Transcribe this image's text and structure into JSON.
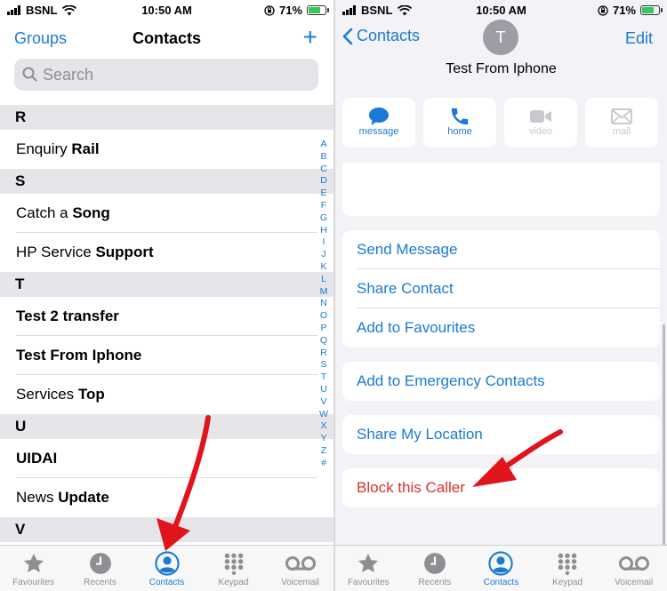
{
  "status": {
    "carrier": "BSNL",
    "time": "10:50 AM",
    "battery": "71%"
  },
  "left": {
    "nav": {
      "groups": "Groups",
      "title": "Contacts",
      "add": "+"
    },
    "search": {
      "placeholder": "Search"
    },
    "sections": [
      {
        "letter": "R",
        "rows": [
          {
            "first": "Enquiry ",
            "last": "Rail"
          }
        ]
      },
      {
        "letter": "S",
        "rows": [
          {
            "first": "Catch a ",
            "last": "Song"
          },
          {
            "first": "HP Service ",
            "last": "Support"
          }
        ]
      },
      {
        "letter": "T",
        "rows": [
          {
            "first": "",
            "last": "Test 2 transfer"
          },
          {
            "first": "",
            "last": "Test From Iphone"
          },
          {
            "first": "Services ",
            "last": "Top"
          }
        ]
      },
      {
        "letter": "U",
        "rows": [
          {
            "first": "",
            "last": "UIDAI"
          },
          {
            "first": "News ",
            "last": "Update"
          }
        ]
      },
      {
        "letter": "V",
        "rows": []
      }
    ],
    "index": [
      "A",
      "B",
      "C",
      "D",
      "E",
      "F",
      "G",
      "H",
      "I",
      "J",
      "K",
      "L",
      "M",
      "N",
      "O",
      "P",
      "Q",
      "R",
      "S",
      "T",
      "U",
      "V",
      "W",
      "X",
      "Y",
      "Z",
      "#"
    ]
  },
  "tabs": [
    {
      "label": "Favourites",
      "icon": "star-icon"
    },
    {
      "label": "Recents",
      "icon": "clock-icon"
    },
    {
      "label": "Contacts",
      "icon": "person-circle-icon",
      "active": true
    },
    {
      "label": "Keypad",
      "icon": "keypad-icon"
    },
    {
      "label": "Voicemail",
      "icon": "voicemail-icon"
    }
  ],
  "right": {
    "back": "Contacts",
    "edit": "Edit",
    "avatar_initial": "T",
    "contact_name": "Test From Iphone",
    "actions": [
      {
        "label": "message",
        "icon": "message-bubble-icon",
        "enabled": true
      },
      {
        "label": "home",
        "icon": "phone-icon",
        "enabled": true
      },
      {
        "label": "video",
        "icon": "video-camera-icon",
        "enabled": false
      },
      {
        "label": "mail",
        "icon": "envelope-icon",
        "enabled": false
      }
    ],
    "menu": {
      "send_message": "Send Message",
      "share_contact": "Share Contact",
      "add_favourites": "Add to Favourites",
      "add_emergency": "Add to Emergency Contacts",
      "share_location": "Share My Location",
      "block_caller": "Block this Caller"
    }
  },
  "colors": {
    "accent": "#1a7ad4",
    "destructive": "#d8332a",
    "annotation_arrow": "#e0141c"
  }
}
